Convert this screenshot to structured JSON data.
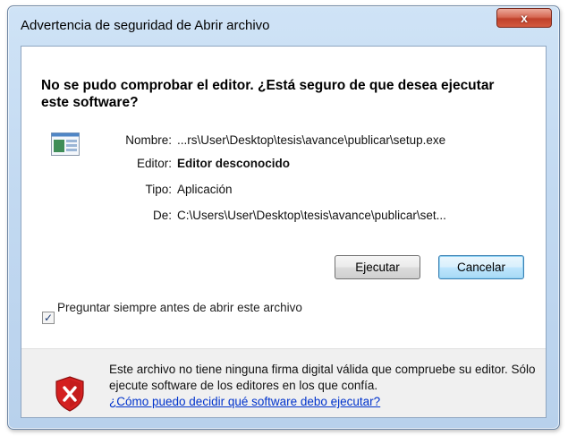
{
  "window": {
    "title": "Advertencia de seguridad de Abrir archivo",
    "close_label": "x"
  },
  "dialog": {
    "heading": "No se pudo comprobar el editor. ¿Está seguro de que desea ejecutar este software?",
    "fields": {
      "name_label": "Nombre:",
      "name_value": "...rs\\User\\Desktop\\tesis\\avance\\publicar\\setup.exe",
      "publisher_label": "Editor:",
      "publisher_value": "Editor desconocido",
      "type_label": "Tipo:",
      "type_value": "Aplicación",
      "from_label": "De:",
      "from_value": "C:\\Users\\User\\Desktop\\tesis\\avance\\publicar\\set..."
    },
    "buttons": {
      "run": "Ejecutar",
      "cancel": "Cancelar"
    },
    "checkbox": {
      "label": "Preguntar siempre antes de abrir este archivo",
      "checked": true,
      "mark": "✓"
    },
    "warning": {
      "text": "Este archivo no tiene ninguna firma digital válida que compruebe su editor. Sólo ejecute software de los editores en los que confía.",
      "link": "¿Cómo puedo decidir qué software debo ejecutar?"
    }
  },
  "colors": {
    "link": "#0033cc",
    "shield_red": "#d42020",
    "title_bar": "#c2d9f1"
  },
  "icons": [
    "application-icon",
    "close-icon",
    "shield-error-icon"
  ]
}
